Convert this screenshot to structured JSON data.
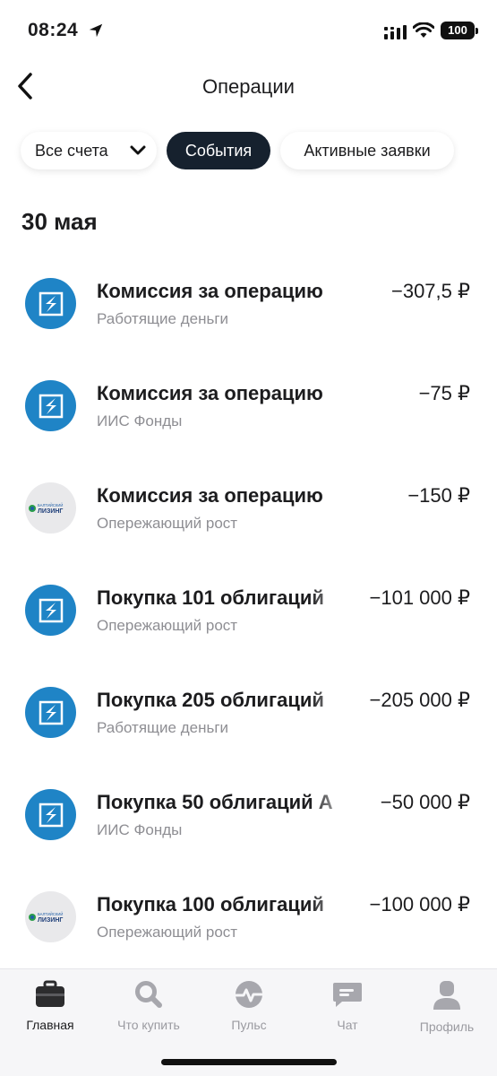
{
  "status_bar": {
    "time": "08:24",
    "battery": "100"
  },
  "header": {
    "title": "Операции"
  },
  "filters": {
    "accounts": "Все счета",
    "events": "События",
    "active_requests": "Активные заявки"
  },
  "date_header": "30 мая",
  "operations": [
    {
      "title": "Комиссия за операцию",
      "subtitle": "Работящие деньги",
      "amount": "−307,5 ₽",
      "icon": "brand-logo-icon"
    },
    {
      "title": "Комиссия за операцию",
      "subtitle": "ИИС Фонды",
      "amount": "−75 ₽",
      "icon": "brand-logo-icon"
    },
    {
      "title": "Комиссия за операцию",
      "subtitle": "Опережающий рост",
      "amount": "−150 ₽",
      "icon": "baltic-leasing-logo-icon",
      "icon_text_top": "БАЛТИЙСКИЙ",
      "icon_text_bottom": "ЛИЗИНГ"
    },
    {
      "title": "Покупка 101 облигаций",
      "subtitle": "Опережающий рост",
      "amount": "−101 000 ₽",
      "icon": "brand-logo-icon"
    },
    {
      "title": "Покупка 205 облигаций",
      "subtitle": "Работящие деньги",
      "amount": "−205 000 ₽",
      "icon": "brand-logo-icon"
    },
    {
      "title": "Покупка 50 облигаций А",
      "subtitle": "ИИС Фонды",
      "amount": "−50 000 ₽",
      "icon": "brand-logo-icon"
    },
    {
      "title": "Покупка 100 облигаций",
      "subtitle": "Опережающий рост",
      "amount": "−100 000 ₽",
      "icon": "baltic-leasing-logo-icon",
      "icon_text_top": "БАЛТИЙСКИЙ",
      "icon_text_bottom": "ЛИЗИНГ"
    }
  ],
  "tabbar": {
    "items": [
      {
        "label": "Главная",
        "icon": "briefcase-icon",
        "active": true
      },
      {
        "label": "Что купить",
        "icon": "search-icon",
        "active": false
      },
      {
        "label": "Пульс",
        "icon": "pulse-icon",
        "active": false
      },
      {
        "label": "Чат",
        "icon": "chat-icon",
        "active": false
      },
      {
        "label": "Профиль",
        "icon": "profile-icon",
        "active": false
      }
    ]
  },
  "colors": {
    "brand_blue": "#1f84c6",
    "chip_active_bg": "#16212e",
    "secondary_text": "#8e8e93"
  }
}
